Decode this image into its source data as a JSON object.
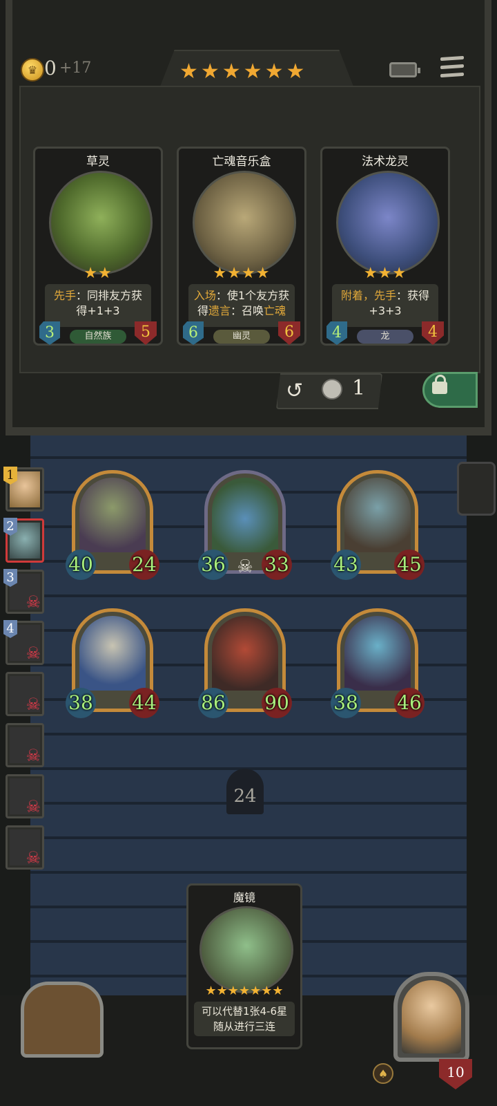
{
  "header": {
    "gold": "0",
    "gold_income": "+17",
    "tier_stars": "★★★★★★"
  },
  "shop": {
    "cards": [
      {
        "name": "草灵",
        "stars": "★★",
        "keyword1": "先手",
        "text1": "：同排友方获",
        "keyword2": "",
        "text2": "得+1+3",
        "attack": "3",
        "health": "5",
        "tribe": "自然族",
        "tribe_color": "#2f5a36"
      },
      {
        "name": "亡魂音乐盒",
        "stars": "★★★★",
        "keyword1": "入场",
        "text1": "：使1个友方获",
        "keyword2": "遗言",
        "text2": "：召唤",
        "keyword3": "亡魂",
        "attack": "6",
        "health": "6",
        "tribe": "幽灵",
        "tribe_color": "#5a5a3c"
      },
      {
        "name": "法术龙灵",
        "stars": "★★★",
        "keyword1": "附着，先手",
        "text1": "：获得",
        "keyword2": "",
        "text2": "+3+3",
        "attack": "4",
        "health": "4",
        "tribe": "龙",
        "tribe_color": "#4a5068"
      }
    ],
    "refresh_icon": "↺",
    "refresh_cost": "1"
  },
  "board": {
    "minions": [
      {
        "attack": "40",
        "health": "24"
      },
      {
        "attack": "36",
        "health": "33"
      },
      {
        "attack": "43",
        "health": "45"
      },
      {
        "attack": "38",
        "health": "44"
      },
      {
        "attack": "86",
        "health": "90"
      },
      {
        "attack": "38",
        "health": "46"
      }
    ],
    "turn": "24"
  },
  "opponents": [
    {
      "rank": "1"
    },
    {
      "rank": "2"
    },
    {
      "rank": "3"
    },
    {
      "rank": "4"
    }
  ],
  "hand": {
    "name": "魔镜",
    "stars": "★★★★★★★",
    "line1": "可以代替1张4-6星",
    "line2": "随从进行三连"
  },
  "hero": {
    "health": "10",
    "power_icon": "♠"
  }
}
